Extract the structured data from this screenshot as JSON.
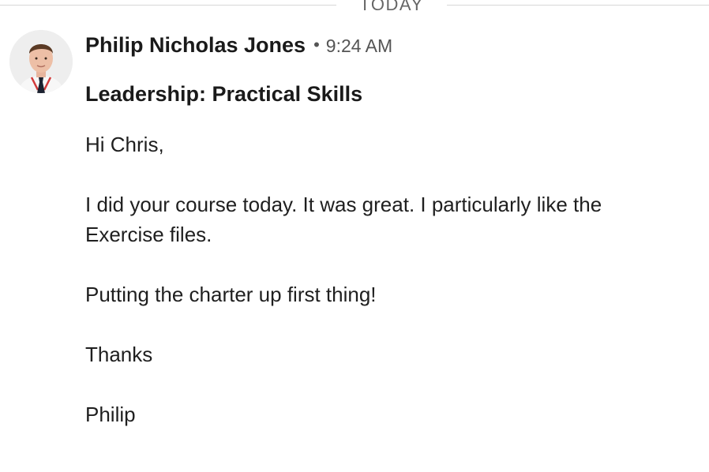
{
  "divider": {
    "label": "TODAY"
  },
  "message": {
    "sender_name": "Philip Nicholas Jones",
    "separator": "•",
    "time": "9:24 AM",
    "subject": "Leadership: Practical Skills",
    "body_paragraphs": [
      "Hi Chris,",
      "I did your course today. It was great. I particularly like the Exercise files.",
      "Putting the charter up first thing!",
      "Thanks",
      "Philip"
    ]
  },
  "colors": {
    "text": "#1f1f1f",
    "muted": "#555555",
    "divider": "#d6d6d6"
  }
}
